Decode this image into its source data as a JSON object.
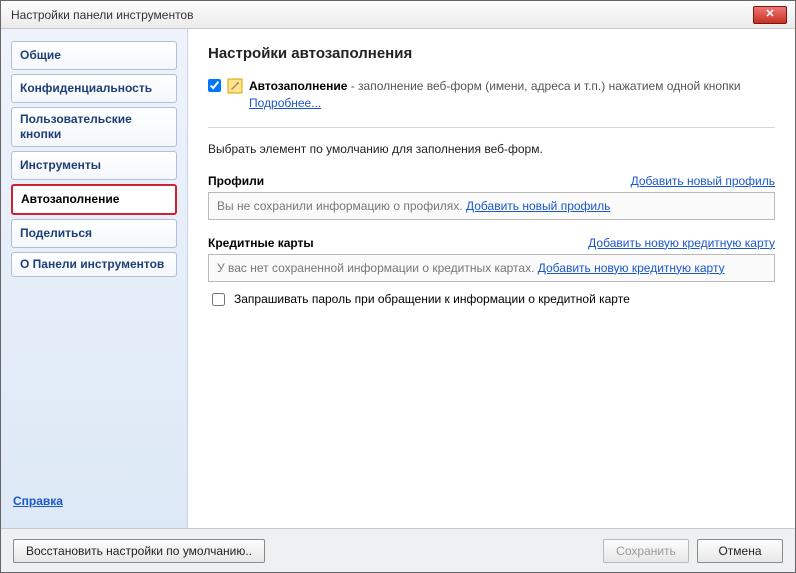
{
  "window": {
    "title": "Настройки панели инструментов"
  },
  "sidebar": {
    "items": [
      {
        "label": "Общие"
      },
      {
        "label": "Конфиденциальность"
      },
      {
        "label": "Пользовательские кнопки"
      },
      {
        "label": "Инструменты"
      },
      {
        "label": "Автозаполнение"
      },
      {
        "label": "Поделиться"
      },
      {
        "label": "О Панели инструментов"
      }
    ],
    "active_index": 4,
    "help_label": "Справка"
  },
  "content": {
    "page_title": "Настройки автозаполнения",
    "autofill": {
      "checkbox_checked": true,
      "feature_name": "Автозаполнение",
      "description": " - заполнение веб-форм (имени, адреса и т.п.) нажатием одной кнопки   ",
      "more_link": "Подробнее..."
    },
    "instruction": "Выбрать элемент по умолчанию для заполнения веб-форм.",
    "profiles": {
      "label": "Профили",
      "add_link": "Добавить новый профиль",
      "empty_text": "Вы не сохранили информацию о профилях. ",
      "empty_link": "Добавить новый профиль"
    },
    "cards": {
      "label": "Кредитные карты",
      "add_link": "Добавить новую кредитную карту",
      "empty_text": "У вас нет сохраненной информации о кредитных картах. ",
      "empty_link": "Добавить новую кредитную карту",
      "request_pw_label": "Запрашивать пароль при обращении к информации о кредитной карте",
      "request_pw_checked": false
    }
  },
  "footer": {
    "restore_defaults": "Восстановить настройки по умолчанию..",
    "save": "Сохранить",
    "cancel": "Отмена"
  }
}
